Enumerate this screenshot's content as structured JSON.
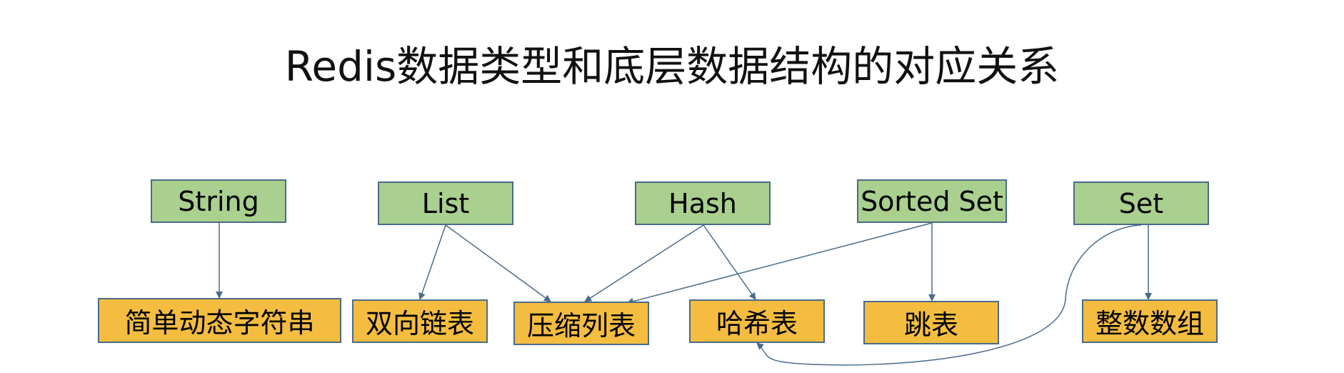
{
  "title": "Redis数据类型和底层数据结构的对应关系",
  "colors": {
    "type_fill": "#a9d08e",
    "struct_fill": "#f4bd40",
    "border": "#4a6b8a",
    "edge": "#4a6b8a"
  },
  "types": [
    {
      "id": "string",
      "label": "String"
    },
    {
      "id": "list",
      "label": "List"
    },
    {
      "id": "hash",
      "label": "Hash"
    },
    {
      "id": "zset",
      "label": "Sorted Set"
    },
    {
      "id": "set",
      "label": "Set"
    }
  ],
  "structures": [
    {
      "id": "sds",
      "label": "简单动态字符串"
    },
    {
      "id": "linkedlist",
      "label": "双向链表"
    },
    {
      "id": "ziplist",
      "label": "压缩列表"
    },
    {
      "id": "hashtable",
      "label": "哈希表"
    },
    {
      "id": "skiplist",
      "label": "跳表"
    },
    {
      "id": "intset",
      "label": "整数数组"
    }
  ],
  "edges": [
    {
      "from": "string",
      "to": "sds"
    },
    {
      "from": "list",
      "to": "linkedlist"
    },
    {
      "from": "list",
      "to": "ziplist"
    },
    {
      "from": "hash",
      "to": "ziplist"
    },
    {
      "from": "hash",
      "to": "hashtable"
    },
    {
      "from": "zset",
      "to": "ziplist"
    },
    {
      "from": "zset",
      "to": "skiplist"
    },
    {
      "from": "set",
      "to": "hashtable"
    },
    {
      "from": "set",
      "to": "intset"
    }
  ]
}
